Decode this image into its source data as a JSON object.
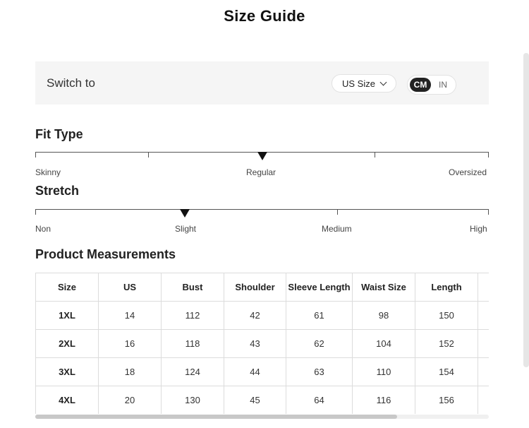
{
  "title": "Size Guide",
  "switch": {
    "label": "Switch to",
    "size_system": "US Size",
    "units": [
      "CM",
      "IN"
    ],
    "active_unit": "CM"
  },
  "fit_type": {
    "title": "Fit Type",
    "labels": [
      "Skinny",
      "Regular",
      "Oversized"
    ],
    "selected": "Regular",
    "level": 0.5
  },
  "stretch": {
    "title": "Stretch",
    "labels": [
      "Non",
      "Slight",
      "Medium",
      "High"
    ],
    "selected": "Slight",
    "level": 0.33
  },
  "measurements": {
    "title": "Product Measurements",
    "headers": [
      "Size",
      "US",
      "Bust",
      "Shoulder",
      "Sleeve Length",
      "Waist Size",
      "Length",
      ""
    ],
    "rows": [
      [
        "1XL",
        "14",
        "112",
        "42",
        "61",
        "98",
        "150",
        ""
      ],
      [
        "2XL",
        "16",
        "118",
        "43",
        "62",
        "104",
        "152",
        ""
      ],
      [
        "3XL",
        "18",
        "124",
        "44",
        "63",
        "110",
        "154",
        ""
      ],
      [
        "4XL",
        "20",
        "130",
        "45",
        "64",
        "116",
        "156",
        ""
      ]
    ]
  },
  "colors": {
    "panel_bg": "#f5f5f5",
    "active_toggle": "#222222",
    "marker": "#111111"
  }
}
